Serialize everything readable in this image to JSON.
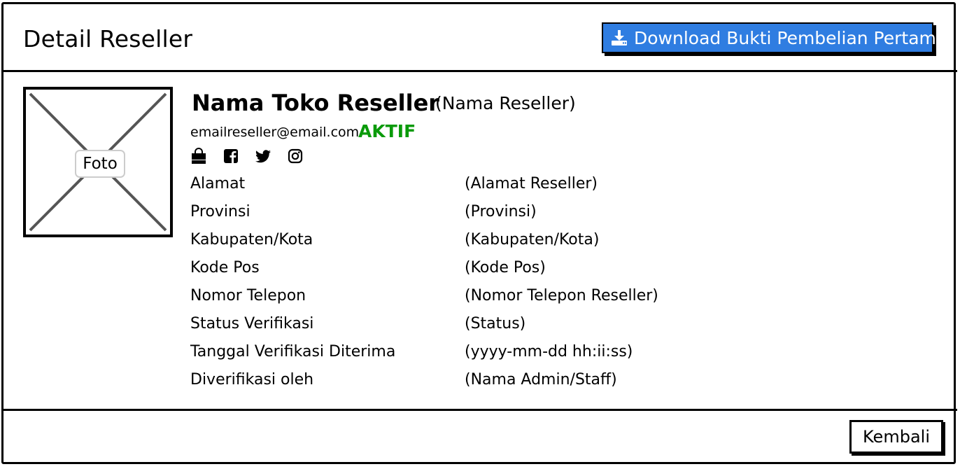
{
  "header": {
    "title": "Detail Reseller",
    "download_button_label": "Download Bukti Pembelian Pertama",
    "download_icon": "download-icon"
  },
  "profile": {
    "photo_label": "Foto",
    "store_name": "Nama Toko Reseller",
    "reseller_name": "(Nama Reseller)",
    "email": "emailreseller@email.com",
    "status": "AKTIF",
    "status_color": "#0a9a0a",
    "socials": [
      "shopping-bag-icon",
      "facebook-icon",
      "twitter-icon",
      "instagram-icon"
    ]
  },
  "details": [
    {
      "label": "Alamat",
      "value": "(Alamat Reseller)"
    },
    {
      "label": "Provinsi",
      "value": "(Provinsi)"
    },
    {
      "label": "Kabupaten/Kota",
      "value": "(Kabupaten/Kota)"
    },
    {
      "label": "Kode Pos",
      "value": "(Kode Pos)"
    },
    {
      "label": "Nomor Telepon",
      "value": "(Nomor Telepon Reseller)"
    },
    {
      "label": "Status Verifikasi",
      "value": "(Status)"
    },
    {
      "label": "Tanggal Verifikasi Diterima",
      "value": "(yyyy-mm-dd hh:ii:ss)"
    },
    {
      "label": "Diverifikasi oleh",
      "value": "(Nama Admin/Staff)"
    }
  ],
  "footer": {
    "back_button_label": "Kembali"
  },
  "colors": {
    "accent": "#2f7de1"
  }
}
